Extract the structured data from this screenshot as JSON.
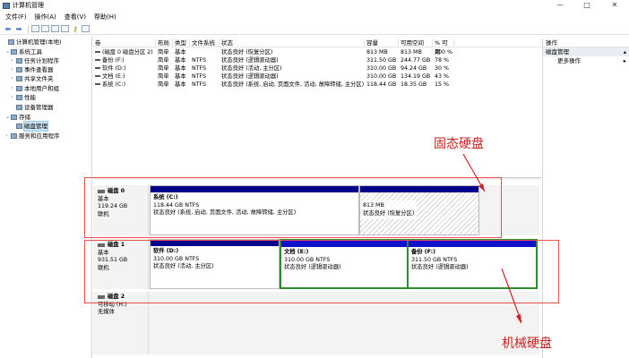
{
  "window": {
    "title": "计算机管理",
    "controls": [
      "—",
      "□",
      "✕"
    ]
  },
  "menu": [
    "文件(F)",
    "操作(A)",
    "查看(V)",
    "帮助(H)"
  ],
  "tree": [
    {
      "label": "计算机管理(本地)",
      "level": 0,
      "toggle": "",
      "icon": "computer-icon"
    },
    {
      "label": "系统工具",
      "level": 1,
      "toggle": "⌄",
      "icon": "tools-icon"
    },
    {
      "label": "任务计划程序",
      "level": 2,
      "toggle": "›",
      "icon": "clock-icon"
    },
    {
      "label": "事件查看器",
      "level": 2,
      "toggle": "›",
      "icon": "event-viewer-icon"
    },
    {
      "label": "共享文件夹",
      "level": 2,
      "toggle": "›",
      "icon": "shared-folder-icon"
    },
    {
      "label": "本地用户和组",
      "level": 2,
      "toggle": "›",
      "icon": "users-icon"
    },
    {
      "label": "性能",
      "level": 2,
      "toggle": "›",
      "icon": "performance-icon"
    },
    {
      "label": "设备管理器",
      "level": 2,
      "toggle": "",
      "icon": "device-manager-icon"
    },
    {
      "label": "存储",
      "level": 1,
      "toggle": "⌄",
      "icon": "storage-icon"
    },
    {
      "label": "磁盘管理",
      "level": 2,
      "toggle": "",
      "icon": "disk-icon",
      "selected": true
    },
    {
      "label": "服务和应用程序",
      "level": 1,
      "toggle": "›",
      "icon": "services-icon"
    }
  ],
  "volume_list": {
    "columns": [
      "卷",
      "布局",
      "类型",
      "文件系统",
      "状态",
      "容量",
      "可用空间",
      "% 可用"
    ],
    "rows": [
      [
        "(磁盘 0 磁盘分区 2)",
        "简单",
        "基本",
        "",
        "状态良好 (恢复分区)",
        "813 MB",
        "813 MB",
        "100 %"
      ],
      [
        "备份 (F:)",
        "简单",
        "基本",
        "NTFS",
        "状态良好 (逻辑驱动器)",
        "311.50 GB",
        "244.77 GB",
        "78 %"
      ],
      [
        "软件 (D:)",
        "简单",
        "基本",
        "NTFS",
        "状态良好 (活动, 主分区)",
        "310.00 GB",
        "94.24 GB",
        "30 %"
      ],
      [
        "文档 (E:)",
        "简单",
        "基本",
        "NTFS",
        "状态良好 (逻辑驱动器)",
        "310.00 GB",
        "134.19 GB",
        "43 %"
      ],
      [
        "系统 (C:)",
        "简单",
        "基本",
        "NTFS",
        "状态良好 (系统, 启动, 页面文件, 活动, 故障转储, 主分区)",
        "118.44 GB",
        "18.35 GB",
        "15 %"
      ]
    ]
  },
  "actions": {
    "header": "操作",
    "section": "磁盘管理",
    "more": "更多操作"
  },
  "disks": [
    {
      "name": "磁盘 0",
      "type": "基本",
      "size": "119.24 GB",
      "status": "联机",
      "partitions": [
        {
          "name": "系统 (C:)",
          "size": "118.44 GB NTFS",
          "status": "状态良好 (系统, 启动, 页面文件, 活动, 故障转储, 主分区)"
        },
        {
          "name": "",
          "size": "813 MB",
          "status": "状态良好 (恢复分区)"
        }
      ]
    },
    {
      "name": "磁盘 1",
      "type": "基本",
      "size": "931.51 GB",
      "status": "联机",
      "partitions": [
        {
          "name": "软件 (D:)",
          "size": "310.00 GB NTFS",
          "status": "状态良好 (活动, 主分区)"
        },
        {
          "name": "文档 (E:)",
          "size": "310.00 GB NTFS",
          "status": "状态良好 (逻辑驱动器)"
        },
        {
          "name": "备份 (F:)",
          "size": "311.50 GB NTFS",
          "status": "状态良好 (逻辑驱动器)"
        }
      ]
    },
    {
      "name": "磁盘 2",
      "type": "可移动 (H:)",
      "size": "",
      "status": "无媒体",
      "partitions": []
    }
  ],
  "annotations": {
    "ssd": "固态硬盘",
    "hdd": "机械硬盘",
    "color": "#cc2222"
  }
}
